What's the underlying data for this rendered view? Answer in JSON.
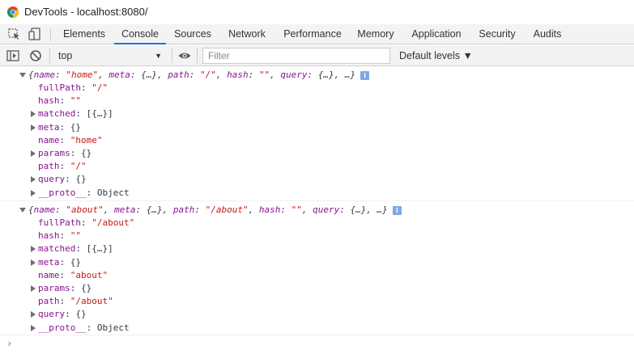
{
  "window": {
    "title": "DevTools - localhost:8080/"
  },
  "tabs": [
    {
      "label": "Elements"
    },
    {
      "label": "Console"
    },
    {
      "label": "Sources"
    },
    {
      "label": "Network"
    },
    {
      "label": "Performance"
    },
    {
      "label": "Memory"
    },
    {
      "label": "Application"
    },
    {
      "label": "Security"
    },
    {
      "label": "Audits"
    }
  ],
  "active_tab": "Console",
  "toolbar": {
    "context": "top",
    "filter_placeholder": "Filter",
    "levels_label": "Default levels ▼"
  },
  "logs": [
    {
      "summary": {
        "open": "{",
        "name_key": "name",
        "name_val": "\"home\"",
        "rest_a": ", ",
        "meta_key": "meta",
        "meta_val": ": {…}, ",
        "path_key": "path",
        "path_sep": ": ",
        "path_val": "\"/\"",
        "hash_sep": ", ",
        "hash_key": "hash",
        "hash_colon": ": ",
        "hash_val": "\"\"",
        "query_sep": ", ",
        "query_key": "query",
        "query_val": ": {…}, …}"
      },
      "props": [
        {
          "key": "fullPath",
          "sep": ": ",
          "val": "\"/\"",
          "type": "string",
          "expandable": false
        },
        {
          "key": "hash",
          "sep": ": ",
          "val": "\"\"",
          "type": "string",
          "expandable": false
        },
        {
          "key": "matched",
          "sep": ": ",
          "val": "[{…}]",
          "type": "obj",
          "expandable": true
        },
        {
          "key": "meta",
          "sep": ": ",
          "val": "{}",
          "type": "obj",
          "expandable": true
        },
        {
          "key": "name",
          "sep": ": ",
          "val": "\"home\"",
          "type": "string",
          "expandable": false
        },
        {
          "key": "params",
          "sep": ": ",
          "val": "{}",
          "type": "obj",
          "expandable": true
        },
        {
          "key": "path",
          "sep": ": ",
          "val": "\"/\"",
          "type": "string",
          "expandable": false
        },
        {
          "key": "query",
          "sep": ": ",
          "val": "{}",
          "type": "obj",
          "expandable": true
        },
        {
          "key": "__proto__",
          "sep": ": ",
          "val": "Object",
          "type": "obj",
          "expandable": true
        }
      ]
    },
    {
      "summary": {
        "open": "{",
        "name_key": "name",
        "name_val": "\"about\"",
        "rest_a": ", ",
        "meta_key": "meta",
        "meta_val": ": {…}, ",
        "path_key": "path",
        "path_sep": ": ",
        "path_val": "\"/about\"",
        "hash_sep": ", ",
        "hash_key": "hash",
        "hash_colon": ": ",
        "hash_val": "\"\"",
        "query_sep": ", ",
        "query_key": "query",
        "query_val": ": {…}, …}"
      },
      "props": [
        {
          "key": "fullPath",
          "sep": ": ",
          "val": "\"/about\"",
          "type": "string",
          "expandable": false
        },
        {
          "key": "hash",
          "sep": ": ",
          "val": "\"\"",
          "type": "string",
          "expandable": false
        },
        {
          "key": "matched",
          "sep": ": ",
          "val": "[{…}]",
          "type": "obj",
          "expandable": true
        },
        {
          "key": "meta",
          "sep": ": ",
          "val": "{}",
          "type": "obj",
          "expandable": true
        },
        {
          "key": "name",
          "sep": ": ",
          "val": "\"about\"",
          "type": "string",
          "expandable": false
        },
        {
          "key": "params",
          "sep": ": ",
          "val": "{}",
          "type": "obj",
          "expandable": true
        },
        {
          "key": "path",
          "sep": ": ",
          "val": "\"/about\"",
          "type": "string",
          "expandable": false
        },
        {
          "key": "query",
          "sep": ": ",
          "val": "{}",
          "type": "obj",
          "expandable": true
        },
        {
          "key": "__proto__",
          "sep": ": ",
          "val": "Object",
          "type": "obj",
          "expandable": true
        }
      ]
    }
  ],
  "info_badge": "i",
  "prompt_symbol": "›",
  "icons": {
    "app": "chrome-logo-icon",
    "inspect": "inspect-element-icon",
    "device": "device-toolbar-icon",
    "sidebar": "show-sidebar-icon",
    "clear": "clear-console-icon",
    "eye": "live-expression-icon"
  },
  "colors": {
    "accent": "#1a73e8",
    "key": "#881391",
    "string": "#c41a16"
  }
}
